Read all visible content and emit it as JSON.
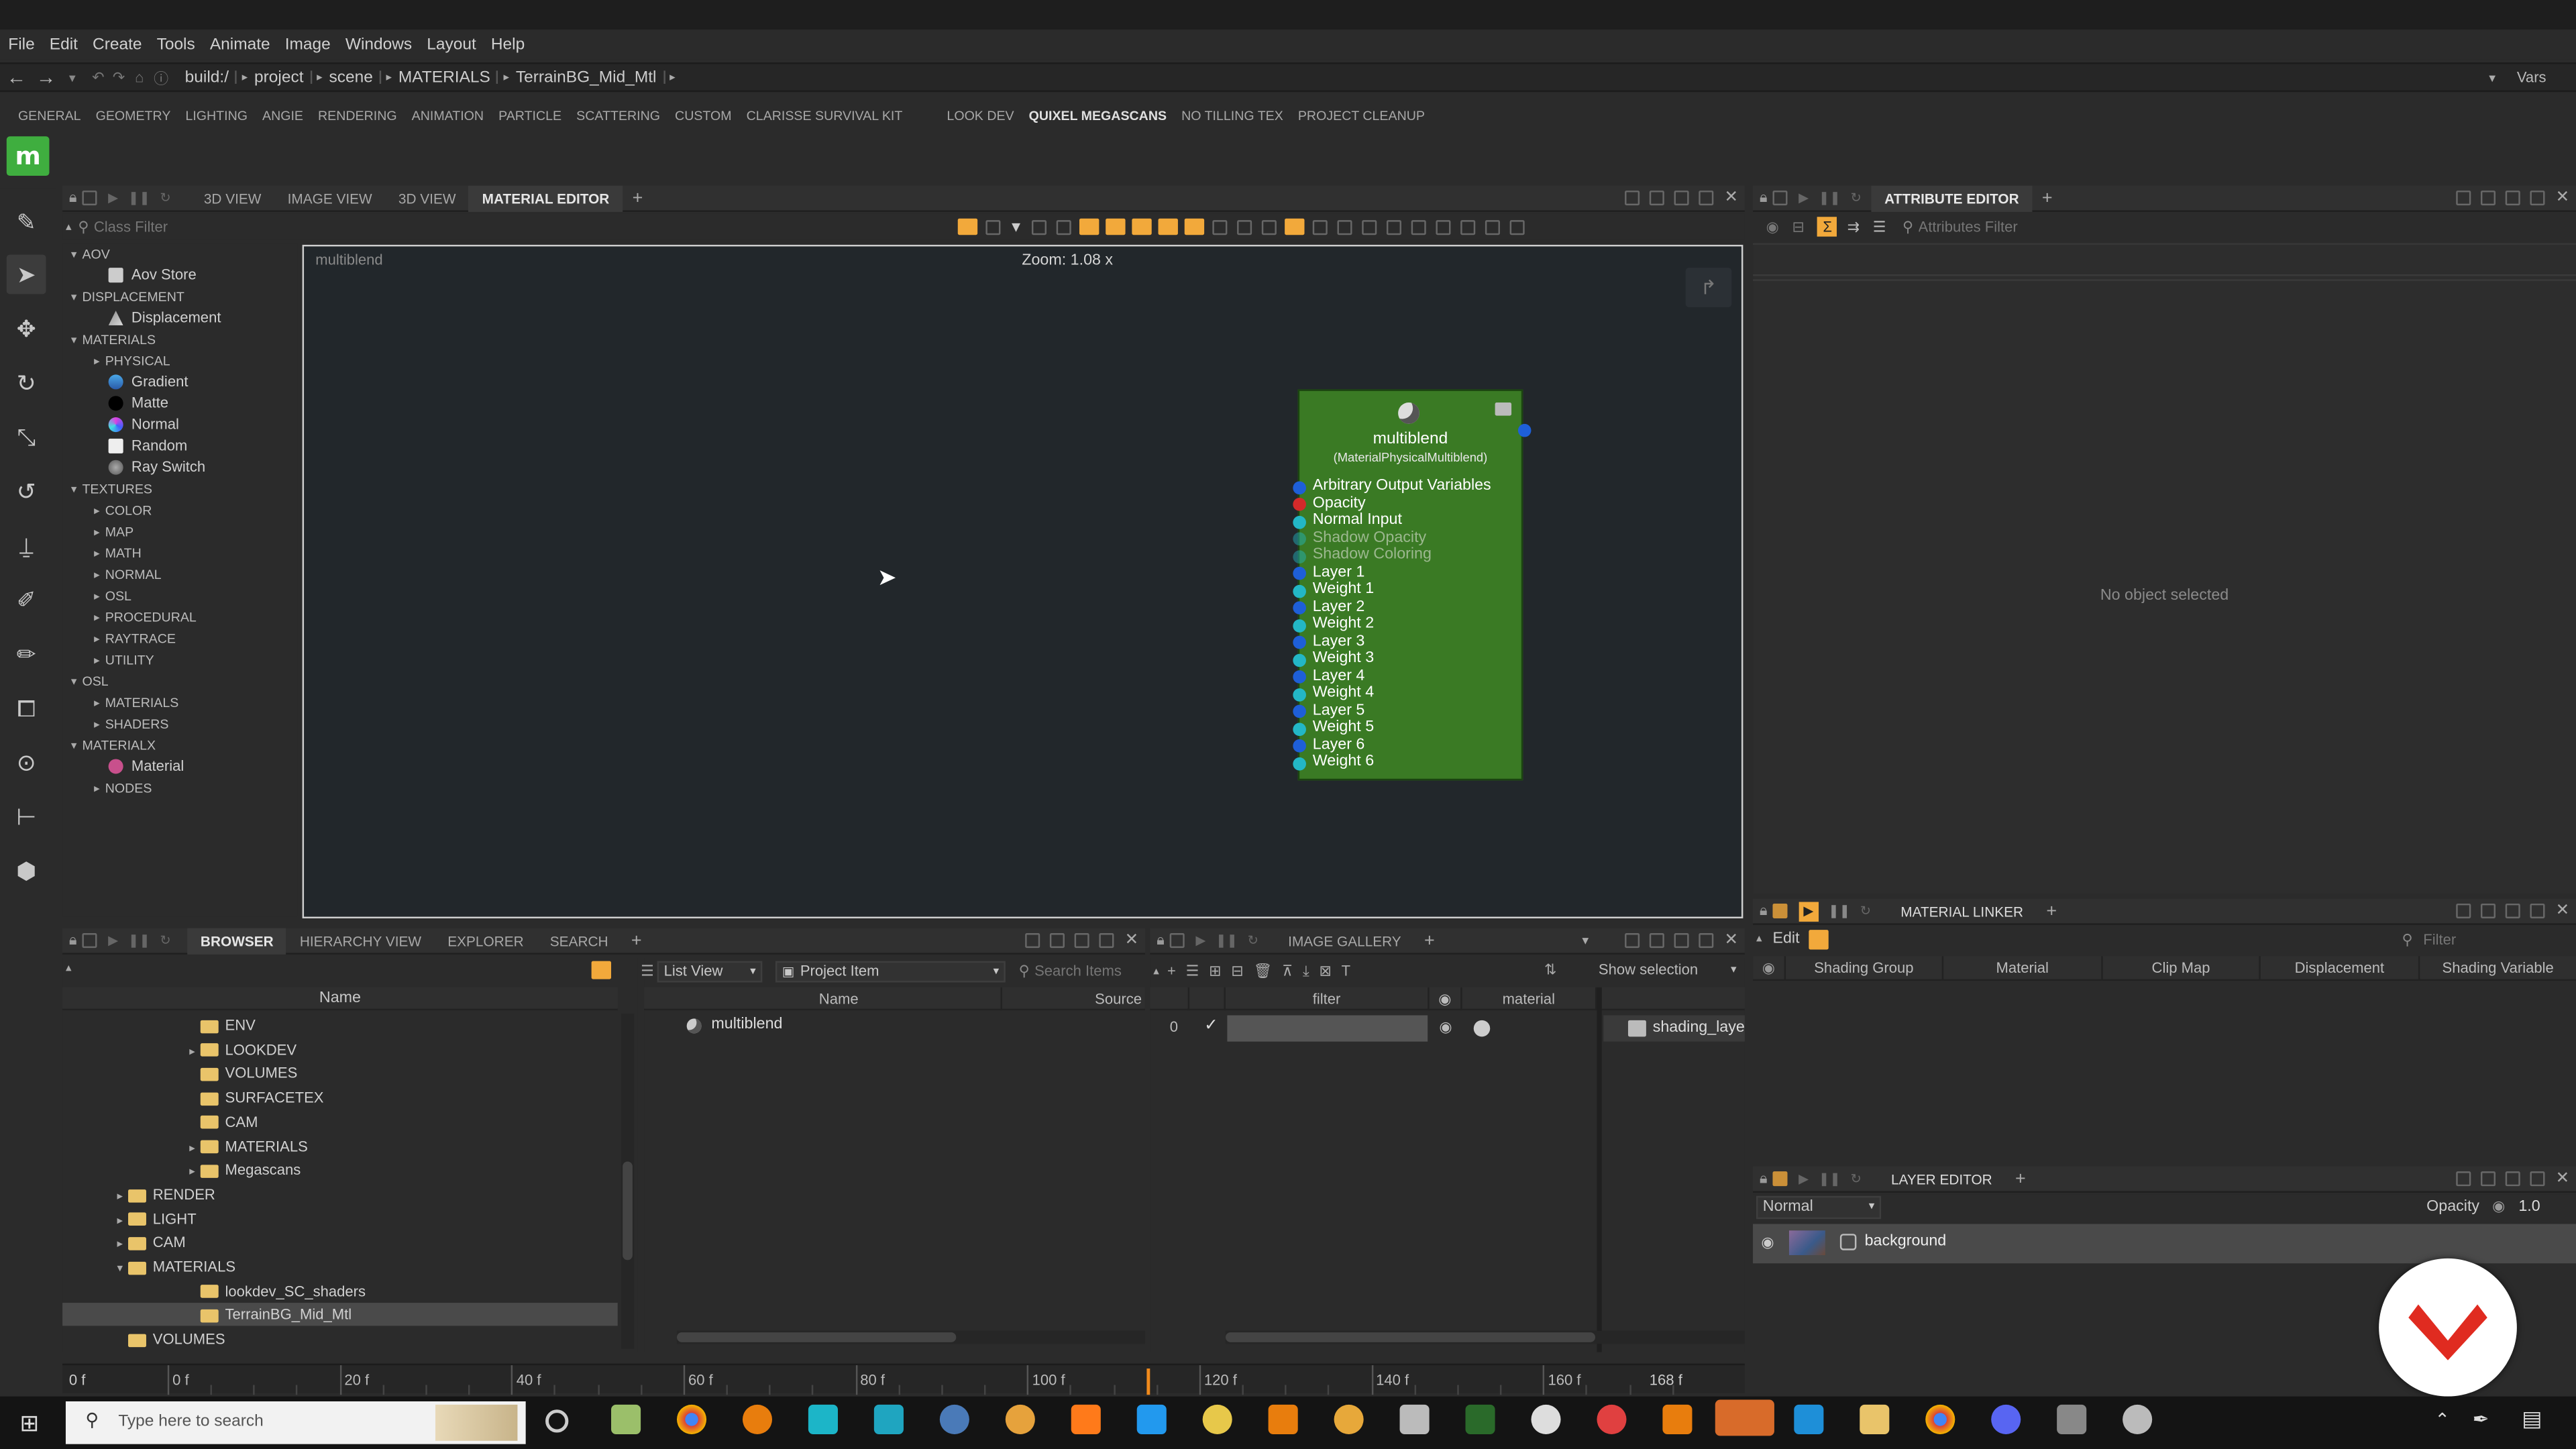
{
  "menu": [
    "File",
    "Edit",
    "Create",
    "Tools",
    "Animate",
    "Image",
    "Windows",
    "Layout",
    "Help"
  ],
  "address": {
    "segments": [
      "build:/",
      "project",
      "scene",
      "MATERIALS",
      "TerrainBG_Mid_Mtl"
    ],
    "vars": "Vars"
  },
  "shelf_tabs": [
    "GENERAL",
    "GEOMETRY",
    "LIGHTING",
    "ANGIE",
    "RENDERING",
    "ANIMATION",
    "PARTICLE",
    "SCATTERING",
    "CUSTOM",
    "CLARISSE SURVIVAL KIT",
    "LOOK DEV",
    "QUIXEL MEGASCANS",
    "NO TILLING TEX",
    "PROJECT CLEANUP"
  ],
  "shelf_logo": "m",
  "viewport_tabs": [
    "3D VIEW",
    "IMAGE VIEW",
    "3D VIEW",
    "MATERIAL EDITOR"
  ],
  "class_filter_placeholder": "Class Filter",
  "tree": [
    {
      "label": "AOV",
      "type": "cat",
      "arrow": "▾"
    },
    {
      "label": "Aov Store",
      "type": "item",
      "icon": "aov"
    },
    {
      "label": "DISPLACEMENT",
      "type": "cat",
      "arrow": "▾"
    },
    {
      "label": "Displacement",
      "type": "item",
      "icon": "disp"
    },
    {
      "label": "MATERIALS",
      "type": "cat",
      "arrow": "▾"
    },
    {
      "label": "PHYSICAL",
      "type": "sub",
      "arrow": "▸"
    },
    {
      "label": "Gradient",
      "type": "item",
      "icon": "gradient"
    },
    {
      "label": "Matte",
      "type": "item",
      "icon": "matte"
    },
    {
      "label": "Normal",
      "type": "item",
      "icon": "normal"
    },
    {
      "label": "Random",
      "type": "item",
      "icon": "random"
    },
    {
      "label": "Ray Switch",
      "type": "item",
      "icon": "rayswitch"
    },
    {
      "label": "TEXTURES",
      "type": "cat",
      "arrow": "▾"
    },
    {
      "label": "COLOR",
      "type": "sub",
      "arrow": "▸"
    },
    {
      "label": "MAP",
      "type": "sub",
      "arrow": "▸"
    },
    {
      "label": "MATH",
      "type": "sub",
      "arrow": "▸"
    },
    {
      "label": "NORMAL",
      "type": "sub",
      "arrow": "▸"
    },
    {
      "label": "OSL",
      "type": "sub",
      "arrow": "▸"
    },
    {
      "label": "PROCEDURAL",
      "type": "sub",
      "arrow": "▸"
    },
    {
      "label": "RAYTRACE",
      "type": "sub",
      "arrow": "▸"
    },
    {
      "label": "UTILITY",
      "type": "sub",
      "arrow": "▸"
    },
    {
      "label": "OSL",
      "type": "cat",
      "arrow": "▾"
    },
    {
      "label": "MATERIALS",
      "type": "sub",
      "arrow": "▸"
    },
    {
      "label": "SHADERS",
      "type": "sub",
      "arrow": "▸"
    },
    {
      "label": "MATERIALX",
      "type": "cat",
      "arrow": "▾"
    },
    {
      "label": "Material",
      "type": "item",
      "icon": "material"
    },
    {
      "label": "NODES",
      "type": "sub",
      "arrow": "▸"
    }
  ],
  "material_editor": {
    "context": "multiblend",
    "zoom": "Zoom: 1.08 x",
    "node": {
      "title": "multiblend",
      "subtitle": "(MaterialPhysicalMultiblend)",
      "ports": [
        {
          "label": "Arbitrary Output Variables",
          "color": "#1e5fd8",
          "dim": false
        },
        {
          "label": "Opacity",
          "color": "#d42a2a",
          "dim": false
        },
        {
          "label": "Normal Input",
          "color": "#23b7c6",
          "dim": false
        },
        {
          "label": "Shadow Opacity",
          "color": "#23b7c6",
          "dim": true
        },
        {
          "label": "Shadow Coloring",
          "color": "#23b7c6",
          "dim": true
        },
        {
          "label": "Layer 1",
          "color": "#1e5fd8",
          "dim": false
        },
        {
          "label": "Weight 1",
          "color": "#23b7c6",
          "dim": false
        },
        {
          "label": "Layer 2",
          "color": "#1e5fd8",
          "dim": false
        },
        {
          "label": "Weight 2",
          "color": "#23b7c6",
          "dim": false
        },
        {
          "label": "Layer 3",
          "color": "#1e5fd8",
          "dim": false
        },
        {
          "label": "Weight 3",
          "color": "#23b7c6",
          "dim": false
        },
        {
          "label": "Layer 4",
          "color": "#1e5fd8",
          "dim": false
        },
        {
          "label": "Weight 4",
          "color": "#23b7c6",
          "dim": false
        },
        {
          "label": "Layer 5",
          "color": "#1e5fd8",
          "dim": false
        },
        {
          "label": "Weight 5",
          "color": "#23b7c6",
          "dim": false
        },
        {
          "label": "Layer 6",
          "color": "#1e5fd8",
          "dim": false
        },
        {
          "label": "Weight 6",
          "color": "#23b7c6",
          "dim": false
        }
      ]
    }
  },
  "attribute_editor": {
    "tab": "ATTRIBUTE EDITOR",
    "filter_placeholder": "Attributes Filter",
    "empty": "No object selected"
  },
  "browser": {
    "tabs": [
      "BROWSER",
      "HIERARCHY VIEW",
      "EXPLORER",
      "SEARCH"
    ],
    "col_name": "Name",
    "folders": [
      {
        "label": "ENV",
        "level": 2,
        "arrow": ""
      },
      {
        "label": "LOOKDEV",
        "level": 2,
        "arrow": "▸"
      },
      {
        "label": "VOLUMES",
        "level": 2,
        "arrow": ""
      },
      {
        "label": "SURFACETEX",
        "level": 2,
        "arrow": ""
      },
      {
        "label": "CAM",
        "level": 2,
        "arrow": ""
      },
      {
        "label": "MATERIALS",
        "level": 2,
        "arrow": "▸"
      },
      {
        "label": "Megascans",
        "level": 2,
        "arrow": "▸"
      },
      {
        "label": "RENDER",
        "level": 1,
        "arrow": "▸"
      },
      {
        "label": "LIGHT",
        "level": 1,
        "arrow": "▸"
      },
      {
        "label": "CAM",
        "level": 1,
        "arrow": "▸"
      },
      {
        "label": "MATERIALS",
        "level": 1,
        "arrow": "▾"
      },
      {
        "label": "lookdev_SC_shaders",
        "level": 2,
        "arrow": ""
      },
      {
        "label": "TerrainBG_Mid_Mtl",
        "level": 2,
        "arrow": "",
        "selected": true
      },
      {
        "label": "VOLUMES",
        "level": 1,
        "arrow": ""
      }
    ],
    "list_view": "List View",
    "project_item": "Project Item",
    "search_placeholder": "Search Items",
    "col_source": "Source",
    "items": [
      "multiblend"
    ]
  },
  "image_gallery": {
    "tab": "IMAGE GALLERY",
    "show_selection": "Show selection",
    "cols": [
      "filter",
      "material"
    ],
    "row_index": "0",
    "shading_layer": "shading_laye"
  },
  "material_linker": {
    "tab": "MATERIAL LINKER",
    "edit": "Edit",
    "filter_placeholder": "Filter",
    "cols": [
      "Shading Group",
      "Material",
      "Clip Map",
      "Displacement",
      "Shading Variable"
    ]
  },
  "layer_editor": {
    "tab": "LAYER EDITOR",
    "blend": "Normal",
    "opacity_label": "Opacity",
    "opacity_value": "1.0",
    "layers": [
      "background"
    ]
  },
  "timeline": {
    "start": "0 f",
    "ticks": [
      "0 f",
      "20 f",
      "40 f",
      "60 f",
      "80 f",
      "100 f",
      "120 f",
      "140 f",
      "160 f"
    ],
    "end": "168 f",
    "current_frame_fraction": 0.682
  },
  "taskbar": {
    "search_placeholder": "Type here to search"
  }
}
